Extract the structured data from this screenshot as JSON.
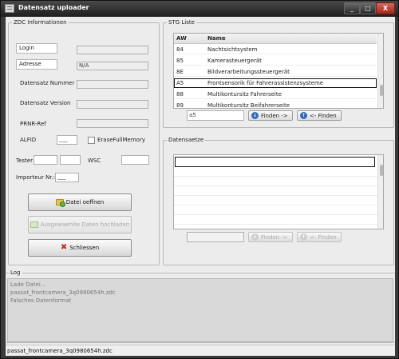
{
  "window": {
    "title": "Datensatz uploader",
    "minimize_glyph": "_",
    "maximize_glyph": "□",
    "close_glyph": "X"
  },
  "zdc": {
    "group_title": "ZDC Informationen",
    "login_label": "Login",
    "adresse_label": "Adresse",
    "adresse_value": "N/A",
    "login_value": "",
    "datensatz_nummer_label": "Datensatz Nummer",
    "datensatz_version_label": "Datensatz Version",
    "prnr_label": "PRNR-Ref",
    "alfid_label": "ALFID",
    "alfid_value": "___",
    "erase_label": "EraseFullMemory",
    "tester_label": "Tester",
    "wsc_label": "WSC",
    "importeur_label": "Importeur Nr.:",
    "importeur_value": "___",
    "open_button": "Datei oeffnen",
    "upload_button": "Ausgewaehlte Daten hochladen",
    "close_button": "Schliessen"
  },
  "stg": {
    "group_title": "STG Liste",
    "columns": [
      "AW",
      "Name"
    ],
    "rows": [
      {
        "aw": "84",
        "name": "Nachtsichtsystem"
      },
      {
        "aw": "85",
        "name": "Kamerasteuergerät"
      },
      {
        "aw": "8E",
        "name": "Bildverarbeitungssteuergerät"
      },
      {
        "aw": "A5",
        "name": "Frontsensorik für Fahrerassistenzsysteme"
      },
      {
        "aw": "88",
        "name": "Multikontursitz Fahrerseite"
      },
      {
        "aw": "89",
        "name": "Multikontursitz Beifahrerseite"
      }
    ],
    "selected_index": 3,
    "search_value": "a5",
    "find_next": "Finden ->",
    "find_prev": "<- Finden"
  },
  "datensaetze": {
    "group_title": "Datensaetze",
    "find_next": "Finden ->",
    "find_prev": "<- Finden"
  },
  "log": {
    "group_title": "Log",
    "lines": [
      "Lade Datei...",
      "passat_frontcamera_3q0980654h.zdc",
      "Falsches Datenformat"
    ]
  },
  "status": {
    "text": "passat_frontcamera_3q0980654h.zdc"
  }
}
